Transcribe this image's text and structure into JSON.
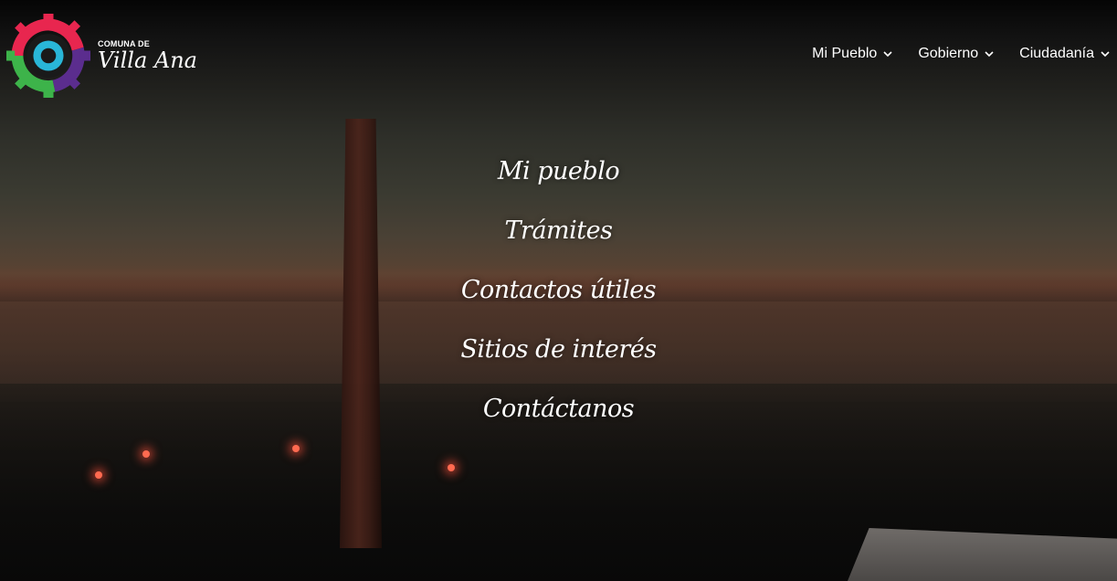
{
  "brand": {
    "small_text": "COMUNA DE",
    "name": "Villa Ana",
    "logo_icon": "gear-eye-logo",
    "colors": {
      "red": "#e8264f",
      "green": "#3db34a",
      "purple": "#5b2d8e",
      "cyan": "#29b6d8"
    }
  },
  "nav": {
    "items": [
      {
        "label": "Mi Pueblo",
        "icon": "chevron-down-icon"
      },
      {
        "label": "Gobierno",
        "icon": "chevron-down-icon"
      },
      {
        "label": "Ciudadanía",
        "icon": "chevron-down-icon"
      }
    ]
  },
  "hero": {
    "links": [
      {
        "label": "Mi pueblo"
      },
      {
        "label": "Trámites"
      },
      {
        "label": "Contactos útiles"
      },
      {
        "label": "Sitios de interés"
      },
      {
        "label": "Contáctanos"
      }
    ]
  }
}
